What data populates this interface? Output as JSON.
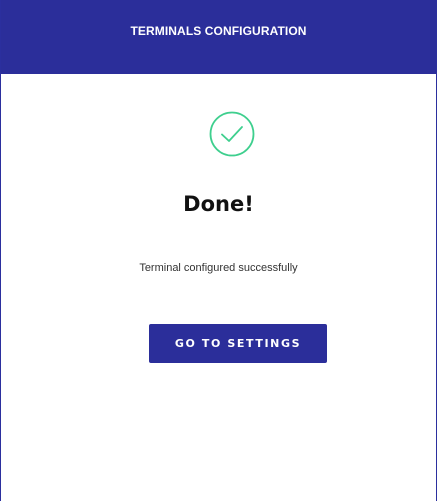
{
  "header": {
    "title": "TERMINALS CONFIGURATION"
  },
  "result": {
    "icon": "check-circle-icon",
    "title": "Done!",
    "message": "Terminal configured successfully"
  },
  "actions": {
    "go_to_settings_label": "GO TO SETTINGS"
  },
  "colors": {
    "primary": "#2b2e9a",
    "success": "#3ecf8e",
    "background": "#ffffff"
  }
}
